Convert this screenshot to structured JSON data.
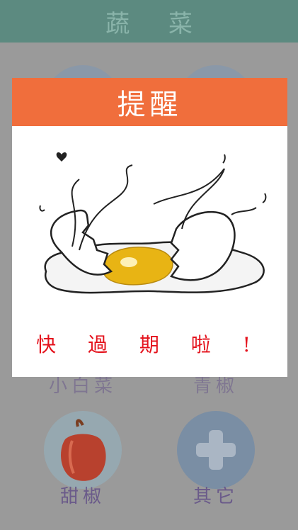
{
  "header": {
    "title": "蔬 菜"
  },
  "grid": {
    "items": [
      {
        "label": "小白菜",
        "icon": "cabbage-icon"
      },
      {
        "label": "青椒",
        "icon": "green-pepper-icon"
      },
      {
        "label": "甜椒",
        "icon": "bell-pepper-icon"
      },
      {
        "label": "其它",
        "icon": "plus-icon"
      }
    ]
  },
  "dialog": {
    "title": "提醒",
    "message": "快 過 期 啦 !",
    "image": "cracked-egg-icon"
  },
  "colors": {
    "header_bg": "#5c8a80",
    "dialog_header": "#f06e3c",
    "message_text": "#e4121c",
    "dim_background": "#9a9a9a"
  }
}
